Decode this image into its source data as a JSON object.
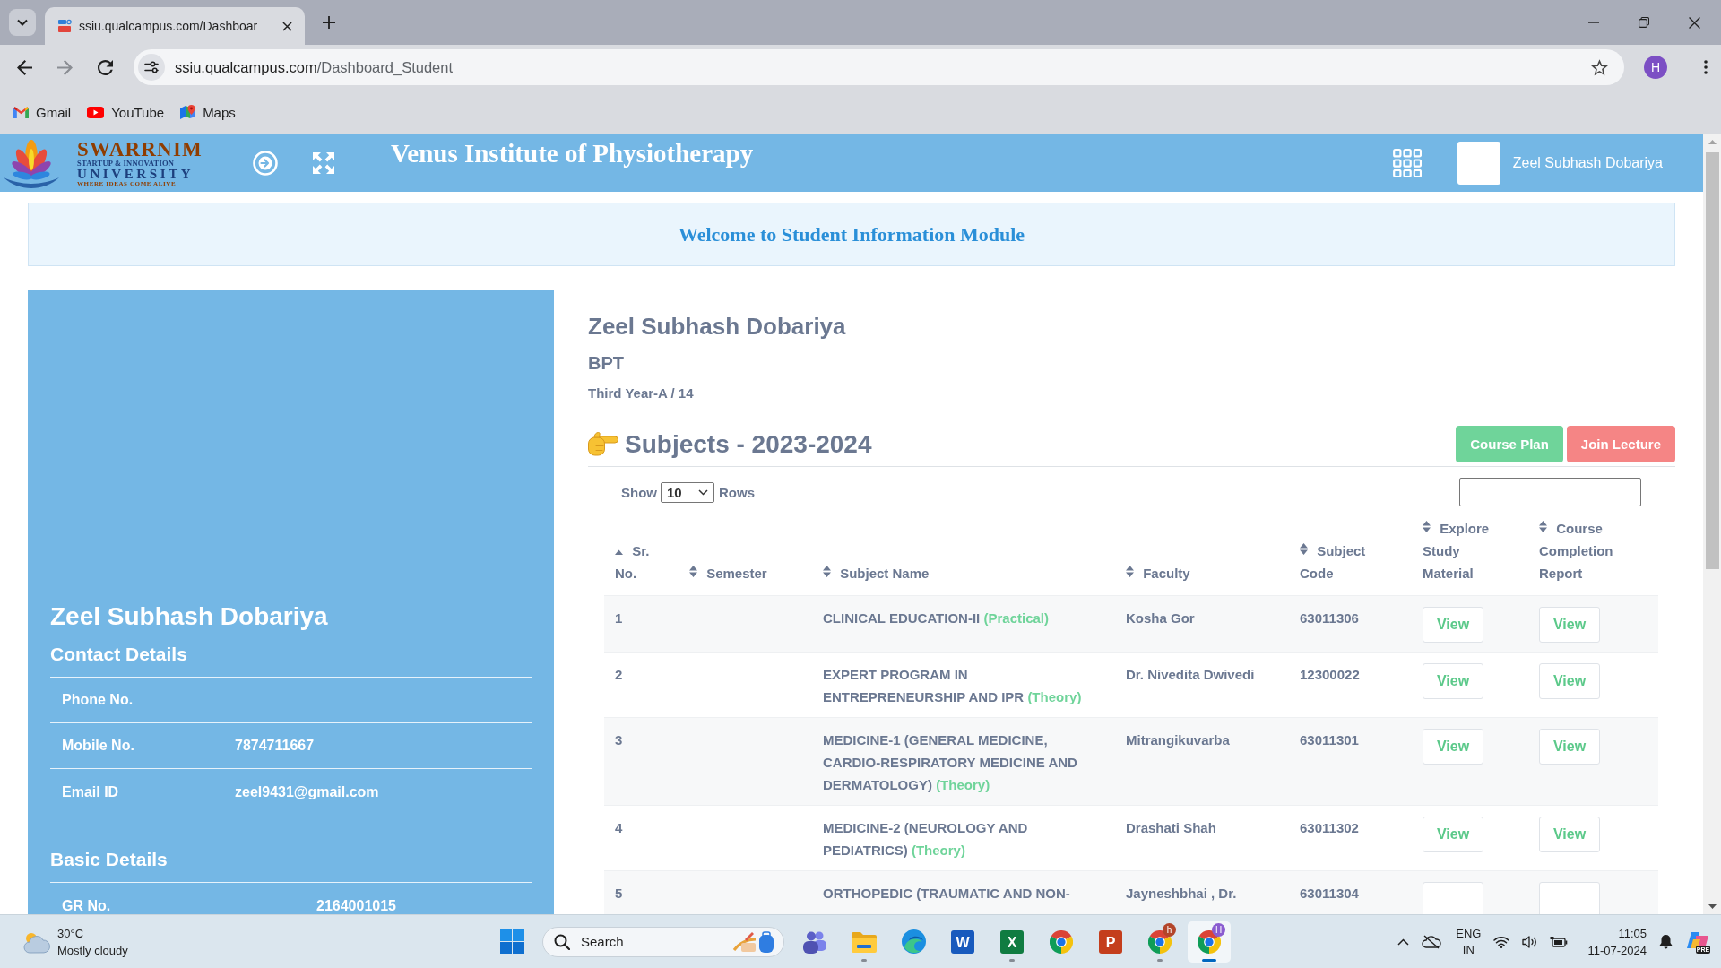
{
  "browser": {
    "tabs": [
      {
        "title": "ssiu.qualcampus.com/Dashboar",
        "selected": true
      }
    ],
    "navigation": [
      {
        "kind": "back",
        "disabled": false
      },
      {
        "kind": "forward",
        "disabled": true
      },
      {
        "kind": "reload",
        "disabled": false
      }
    ],
    "address": {
      "host": "ssiu.qualcampus.com",
      "path": "/Dashboard_Student"
    },
    "profile_initial": "H",
    "bookmarks": [
      {
        "label": "Gmail",
        "kind": "mail"
      },
      {
        "label": "YouTube",
        "kind": "video"
      },
      {
        "label": "Maps",
        "kind": "map"
      }
    ]
  },
  "header": {
    "logo": {
      "name": "SWARRNIM",
      "subtitle": "STARTUP & INNOVATION",
      "university": "UNIVERSITY",
      "tagline": "WHERE IDEAS COME ALIVE"
    },
    "title": "Venus Institute of Physiotherapy",
    "user_name": "Zeel Subhash Dobariya"
  },
  "welcome": "Welcome to Student Information Module",
  "profile_panel": {
    "name": "Zeel Subhash Dobariya",
    "sections": [
      {
        "title": "Contact Details",
        "rows": [
          {
            "label": "Phone No."
          },
          {
            "label": "Mobile No.",
            "value": "7874711667"
          },
          {
            "label": "Email ID",
            "value": "zeel9431@gmail.com"
          }
        ]
      },
      {
        "title": "Basic Details",
        "rows": [
          {
            "label": "GR No.",
            "value": "2164001015"
          }
        ]
      }
    ]
  },
  "student": {
    "name": "Zeel Subhash Dobariya",
    "program": "BPT",
    "class": "Third Year-A / 14"
  },
  "subjects": {
    "title": "Subjects - 2023-2024",
    "buttons": [
      {
        "label": "Course Plan",
        "kind": "success"
      },
      {
        "label": "Join Lecture",
        "kind": "danger"
      }
    ],
    "show_label": "Show",
    "page_size": "10",
    "rows_label": "Rows",
    "table": {
      "columns": [
        {
          "label": "Sr. No.",
          "sorted": true
        },
        {
          "label": "Semester",
          "sorted": false
        },
        {
          "label": "Subject Name",
          "sorted": false
        },
        {
          "label": "Faculty",
          "sorted": false
        },
        {
          "label": "Subject Code",
          "sorted": false
        },
        {
          "label": "Explore Study Material",
          "sorted": false
        },
        {
          "label": "Course Completion Report",
          "sorted": false
        }
      ],
      "rows": [
        {
          "number": "1",
          "subject": "CLINICAL EDUCATION-II",
          "type": "(Practical)",
          "faculty": "Kosha Gor",
          "code": "63011306",
          "study_material": "View",
          "completion_report": "View"
        },
        {
          "number": "2",
          "subject": "EXPERT PROGRAM IN ENTREPRENEURSHIP AND IPR",
          "type": "(Theory)",
          "faculty": "Dr. Nivedita Dwivedi",
          "code": "12300022",
          "study_material": "View",
          "completion_report": "View"
        },
        {
          "number": "3",
          "subject": "MEDICINE-1 (GENERAL MEDICINE, CARDIO-RESPIRATORY MEDICINE AND DERMATOLOGY)",
          "type": "(Theory)",
          "faculty": "Mitrangikuvarba",
          "code": "63011301",
          "study_material": "View",
          "completion_report": "View"
        },
        {
          "number": "4",
          "subject": "MEDICINE-2 (NEUROLOGY AND PEDIATRICS)",
          "type": "(Theory)",
          "faculty": "Drashati Shah",
          "code": "63011302",
          "study_material": "View",
          "completion_report": "View"
        },
        {
          "number": "5",
          "subject": "ORTHOPEDIC (TRAUMATIC AND NON-",
          "faculty": "Jayneshbhai , Dr.",
          "code": "63011304"
        }
      ]
    }
  },
  "taskbar": {
    "weather": {
      "temperature": "30°C",
      "condition": "Mostly cloudy"
    },
    "search": {
      "placeholder": "Search"
    },
    "apps": [
      {
        "kind": "teams",
        "running": false,
        "selected": false
      },
      {
        "kind": "explorer",
        "running": true,
        "selected": false
      },
      {
        "kind": "edge",
        "running": false,
        "selected": false
      },
      {
        "kind": "word",
        "letter": "W",
        "running": false,
        "selected": false
      },
      {
        "kind": "excel",
        "letter": "X",
        "running": true,
        "selected": false
      },
      {
        "kind": "chrome",
        "running": false,
        "selected": false
      },
      {
        "kind": "powerpoint",
        "letter": "P",
        "running": false,
        "selected": false
      },
      {
        "kind": "chrome",
        "badge": "h",
        "color": "#b3452a",
        "running": true,
        "selected": false
      },
      {
        "kind": "chrome",
        "badge": "H",
        "color": "#8a5cd0",
        "running": true,
        "selected": true
      }
    ],
    "language": "ENG",
    "region": "IN",
    "time": "11:05",
    "date": "11-07-2024",
    "copilot_badge": "PRE"
  }
}
